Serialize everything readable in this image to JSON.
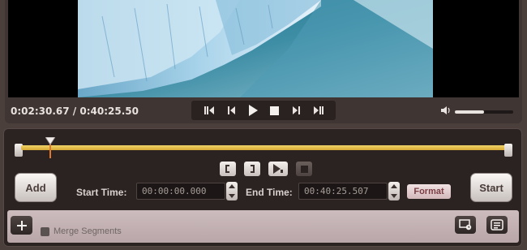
{
  "player": {
    "timecode": "0:02:30.67 / 0:40:25.50",
    "volume_level": 0.5
  },
  "transport": {
    "icons": [
      "skip-back-icon",
      "step-back-icon",
      "play-icon",
      "stop-icon",
      "step-forward-icon",
      "skip-forward-icon"
    ]
  },
  "timeline": {
    "marker_position": 0.06
  },
  "segment_tools": {
    "icons": [
      "set-start-bracket-icon",
      "set-end-bracket-icon",
      "play-segment-icon",
      "stop-segment-icon"
    ]
  },
  "editor": {
    "add_label": "Add",
    "start_time_label": "Start Time:",
    "start_time_value": "00:00:00.000",
    "end_time_label": "End Time:",
    "end_time_value": "00:40:25.507",
    "format_label": "Format",
    "start_label": "Start"
  },
  "footer": {
    "merge_label": "Merge Segments",
    "merge_checked": false
  },
  "colors": {
    "timeline_bar": "#e3bd4c",
    "marker": "#e2772e",
    "format_text": "#7a3d44"
  }
}
